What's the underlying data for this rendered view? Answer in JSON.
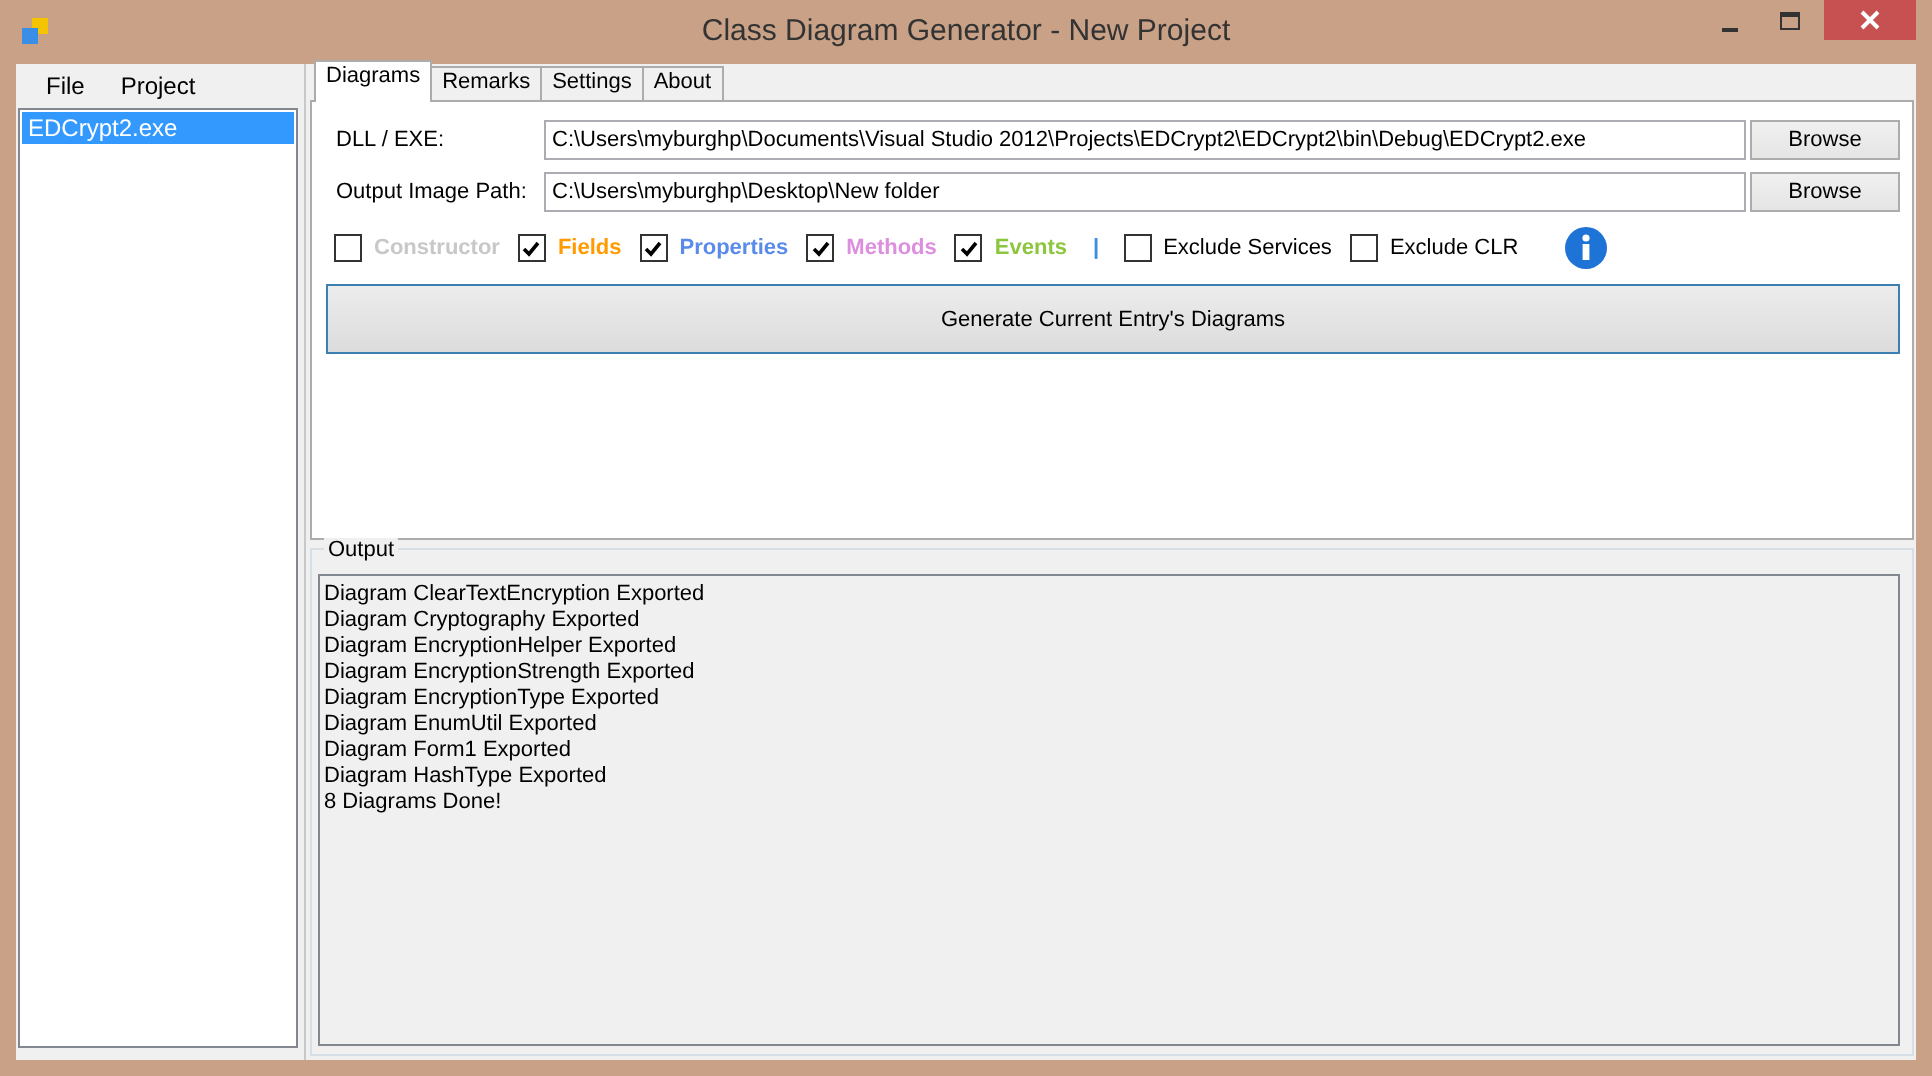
{
  "window": {
    "title": "Class Diagram Generator - New Project"
  },
  "menu": [
    "File",
    "Project"
  ],
  "entries": [
    {
      "label": "EDCrypt2.exe",
      "selected": true
    }
  ],
  "tabs": [
    {
      "label": "Diagrams",
      "selected": true
    },
    {
      "label": "Remarks",
      "selected": false
    },
    {
      "label": "Settings",
      "selected": false
    },
    {
      "label": "About",
      "selected": false
    }
  ],
  "fields": [
    {
      "label": "DLL / EXE:",
      "value": "C:\\Users\\myburghp\\Documents\\Visual Studio 2012\\Projects\\EDCrypt2\\EDCrypt2\\bin\\Debug\\EDCrypt2.exe",
      "button": "Browse"
    },
    {
      "label": "Output Image Path:",
      "value": "C:\\Users\\myburghp\\Desktop\\New folder",
      "button": "Browse"
    }
  ],
  "options": [
    {
      "kind": "checkbox",
      "label": "Constructor",
      "checked": false,
      "color": "#c8c8c8"
    },
    {
      "kind": "checkbox",
      "label": "Fields",
      "checked": true,
      "color": "#ff9a00"
    },
    {
      "kind": "checkbox",
      "label": "Properties",
      "checked": true,
      "color": "#5b8bea"
    },
    {
      "kind": "checkbox",
      "label": "Methods",
      "checked": true,
      "color": "#de8ede"
    },
    {
      "kind": "checkbox",
      "label": "Events",
      "checked": true,
      "color": "#8cc63f"
    },
    {
      "kind": "separator",
      "label": "|",
      "color": "#3b8fe0"
    },
    {
      "kind": "checkbox",
      "label": "Exclude Services",
      "checked": false,
      "color": "#000000"
    },
    {
      "kind": "checkbox",
      "label": "Exclude CLR",
      "checked": false,
      "color": "#000000"
    }
  ],
  "generate_button": "Generate Current Entry's Diagrams",
  "output": {
    "title": "Output",
    "lines": [
      "Diagram ClearTextEncryption Exported",
      "Diagram Cryptography Exported",
      "Diagram EncryptionHelper Exported",
      "Diagram EncryptionStrength Exported",
      "Diagram EncryptionType Exported",
      "Diagram EnumUtil Exported",
      "Diagram Form1 Exported",
      "Diagram HashType Exported",
      "8 Diagrams Done!"
    ]
  }
}
